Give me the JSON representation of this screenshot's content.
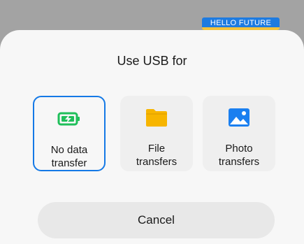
{
  "badge": {
    "text": "HELLO FUTURE"
  },
  "dialog": {
    "title": "Use USB for",
    "options": [
      {
        "line1": "No data",
        "line2": "transfer",
        "icon": "battery-charging-icon",
        "selected": true
      },
      {
        "line1": "File",
        "line2": "transfers",
        "icon": "folder-icon",
        "selected": false
      },
      {
        "line1": "Photo",
        "line2": "transfers",
        "icon": "image-icon",
        "selected": false
      }
    ],
    "cancel_label": "Cancel"
  },
  "colors": {
    "accent": "#1479e6",
    "battery": "#1fbf5a",
    "folder": "#f7b500",
    "photo": "#1a7ff0"
  }
}
